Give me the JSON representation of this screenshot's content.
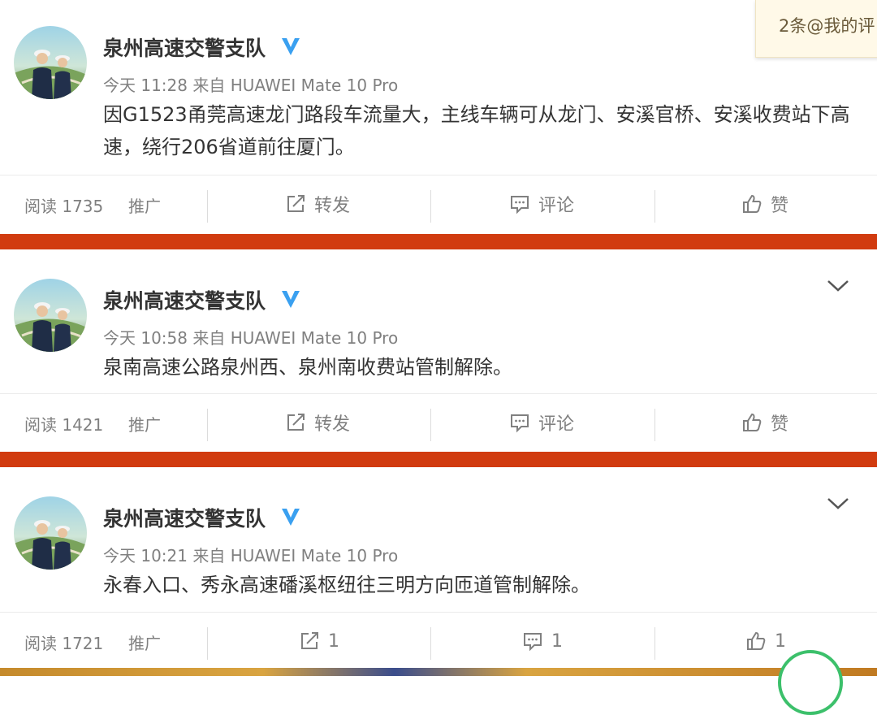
{
  "notification": {
    "text": "2条@我的评"
  },
  "posts": [
    {
      "author": "泉州高速交警支队",
      "verified": true,
      "meta": "今天 11:28 来自 HUAWEI Mate 10 Pro",
      "text": "因G1523甬莞高速龙门路段车流量大，主线车辆可从龙门、安溪官桥、安溪收费站下高速，绕行206省道前往厦门。",
      "read_label": "阅读 1735",
      "promote_label": "推广",
      "repost_label": "转发",
      "comment_label": "评论",
      "like_label": "赞"
    },
    {
      "author": "泉州高速交警支队",
      "verified": true,
      "meta": "今天 10:58 来自 HUAWEI Mate 10 Pro",
      "text": "泉南高速公路泉州西、泉州南收费站管制解除。",
      "read_label": "阅读 1421",
      "promote_label": "推广",
      "repost_label": "转发",
      "comment_label": "评论",
      "like_label": "赞"
    },
    {
      "author": "泉州高速交警支队",
      "verified": true,
      "meta": "今天 10:21 来自 HUAWEI Mate 10 Pro",
      "text": "永春入口、秀永高速磻溪枢纽往三明方向匝道管制解除。",
      "read_label": "阅读 1721",
      "promote_label": "推广",
      "repost_label": "1",
      "comment_label": "1",
      "like_label": "1"
    }
  ],
  "colors": {
    "accent_band": "#d13b0f",
    "verified_badge": "#3aa0f0",
    "meta_text": "#808080"
  },
  "icons": [
    "verified-badge-icon",
    "chevron-down-icon",
    "repost-icon",
    "comment-icon",
    "like-icon"
  ]
}
